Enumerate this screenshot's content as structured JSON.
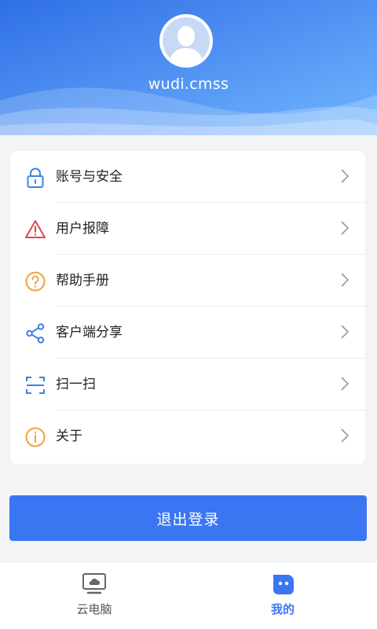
{
  "profile": {
    "username": "wudi.cmss"
  },
  "menu": [
    {
      "label": "账号与安全",
      "icon": "lock-icon",
      "color": "#3c83e6"
    },
    {
      "label": "用户报障",
      "icon": "warning-icon",
      "color": "#e0474c"
    },
    {
      "label": "帮助手册",
      "icon": "question-icon",
      "color": "#f0a23a"
    },
    {
      "label": "客户端分享",
      "icon": "share-icon",
      "color": "#3c83e6"
    },
    {
      "label": "扫一扫",
      "icon": "scan-icon",
      "color": "#3c83e6"
    },
    {
      "label": "关于",
      "icon": "info-icon",
      "color": "#f0a23a"
    }
  ],
  "logout_label": "退出登录",
  "tabs": [
    {
      "label": "云电脑",
      "icon": "cloud-computer-icon",
      "active": false
    },
    {
      "label": "我的",
      "icon": "profile-face-icon",
      "active": true
    }
  ],
  "colors": {
    "primary": "#3b76f2",
    "header_start": "#2f6fe6",
    "header_end": "#6fb4ff",
    "inactive_tab": "#555555",
    "active_tab": "#3b76f2"
  }
}
